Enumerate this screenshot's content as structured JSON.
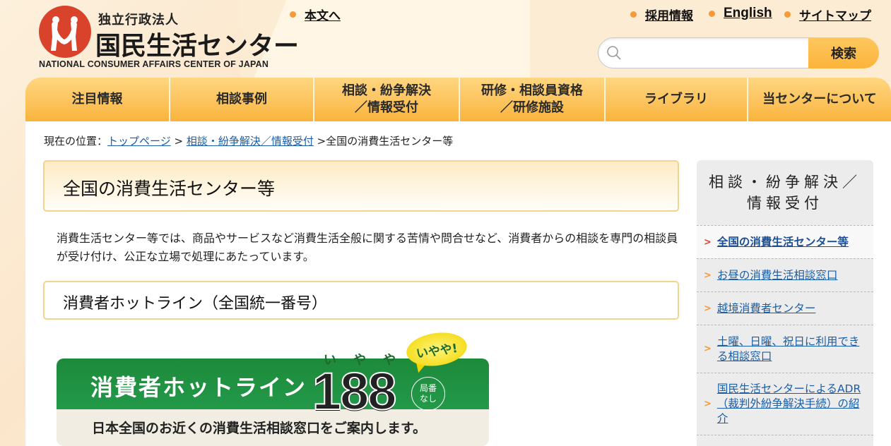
{
  "header": {
    "org_type": "独立行政法人",
    "org_name": "国民生活センター",
    "org_name_en": "NATIONAL CONSUMER AFFAIRS CENTER OF JAPAN",
    "skip_link": "本文へ",
    "links": [
      "採用情報",
      "English",
      "サイトマップ"
    ],
    "search": {
      "placeholder": "",
      "value": "",
      "button_label": "検索",
      "icon": "search-icon"
    }
  },
  "nav": [
    {
      "label": "注目情報"
    },
    {
      "label": "相談事例"
    },
    {
      "label": "相談・紛争解決\n／情報受付"
    },
    {
      "label": "研修・相談員資格\n／研修施設"
    },
    {
      "label": "ライブラリ"
    },
    {
      "label": "当センターについて"
    }
  ],
  "breadcrumb": {
    "prefix": "現在の位置：",
    "items": [
      "トップページ",
      "相談・紛争解決／情報受付"
    ],
    "separator": ">",
    "current": "全国の消費生活センター等"
  },
  "main": {
    "title": "全国の消費生活センター等",
    "intro": "消費生活センター等では、商品やサービスなど消費生活全般に関する苦情や問合せなど、消費者からの相談を専門の相談員が受け付け、公正な立場で処理にあたっています。",
    "section_title": "消費者ホットライン（全国統一番号）",
    "banner": {
      "title": "消費者ホットライン",
      "number": "188",
      "ruby": [
        "い",
        "や",
        "や"
      ],
      "bubble": "いやや!",
      "badge": "局番\nなし",
      "subtitle": "日本全国のお近くの消費生活相談窓口をご案内します。",
      "green": "#1d8a3a"
    }
  },
  "sidebar": {
    "title": "相談・紛争解決／\n情報受付",
    "items": [
      {
        "label": "全国の消費生活センター等",
        "active": true
      },
      {
        "label": "お昼の消費生活相談窓口",
        "active": false
      },
      {
        "label": "越境消費者センター",
        "active": false
      },
      {
        "label": "土曜、日曜、祝日に利用できる相談窓口",
        "active": false
      },
      {
        "label": "国民生活センターによるADR（裁判外紛争解決手続）の紹介",
        "active": false
      }
    ]
  },
  "colors": {
    "accent": "#f39a3a",
    "nav": "#fcc25a",
    "link": "#1a5ea8",
    "logo": "#d9432b"
  }
}
